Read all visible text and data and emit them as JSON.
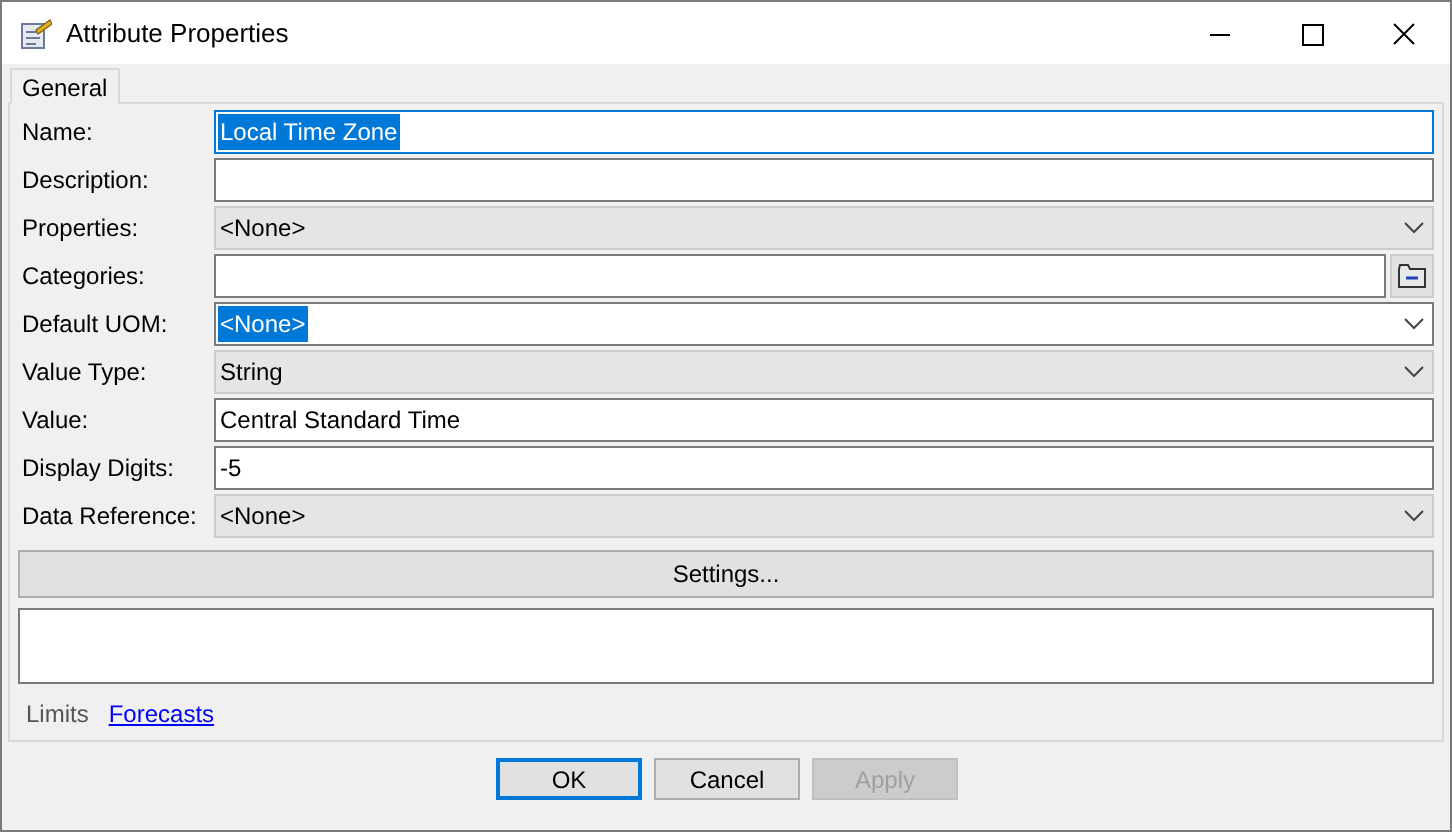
{
  "window": {
    "title": "Attribute Properties"
  },
  "tabs": [
    {
      "label": "General",
      "selected": true
    }
  ],
  "fields": [
    {
      "label": "Name:",
      "kind": "text",
      "value": "Local Time Zone",
      "highlighted": true
    },
    {
      "label": "Description:",
      "kind": "text"
    },
    {
      "label": "Properties:",
      "kind": "combo",
      "value": "<None>"
    },
    {
      "label": "Categories:",
      "kind": "picker"
    },
    {
      "label": "Default UOM:",
      "kind": "editable-combo",
      "value": "<None>",
      "highlighted": true
    },
    {
      "label": "Value Type:",
      "kind": "combo",
      "value": "String"
    },
    {
      "label": "Value:",
      "kind": "text",
      "value": "Central Standard Time"
    },
    {
      "label": "Display Digits:",
      "kind": "text",
      "value": "-5"
    },
    {
      "label": "Data Reference:",
      "kind": "combo",
      "value": "<None>"
    }
  ],
  "settings_button": "Settings...",
  "links": [
    {
      "label": "Limits",
      "disabled": true
    },
    {
      "label": "Forecasts",
      "disabled": false
    }
  ],
  "buttons": [
    {
      "label": "OK",
      "default": true,
      "disabled": false
    },
    {
      "label": "Cancel",
      "default": false,
      "disabled": false
    },
    {
      "label": "Apply",
      "default": false,
      "disabled": true
    }
  ]
}
